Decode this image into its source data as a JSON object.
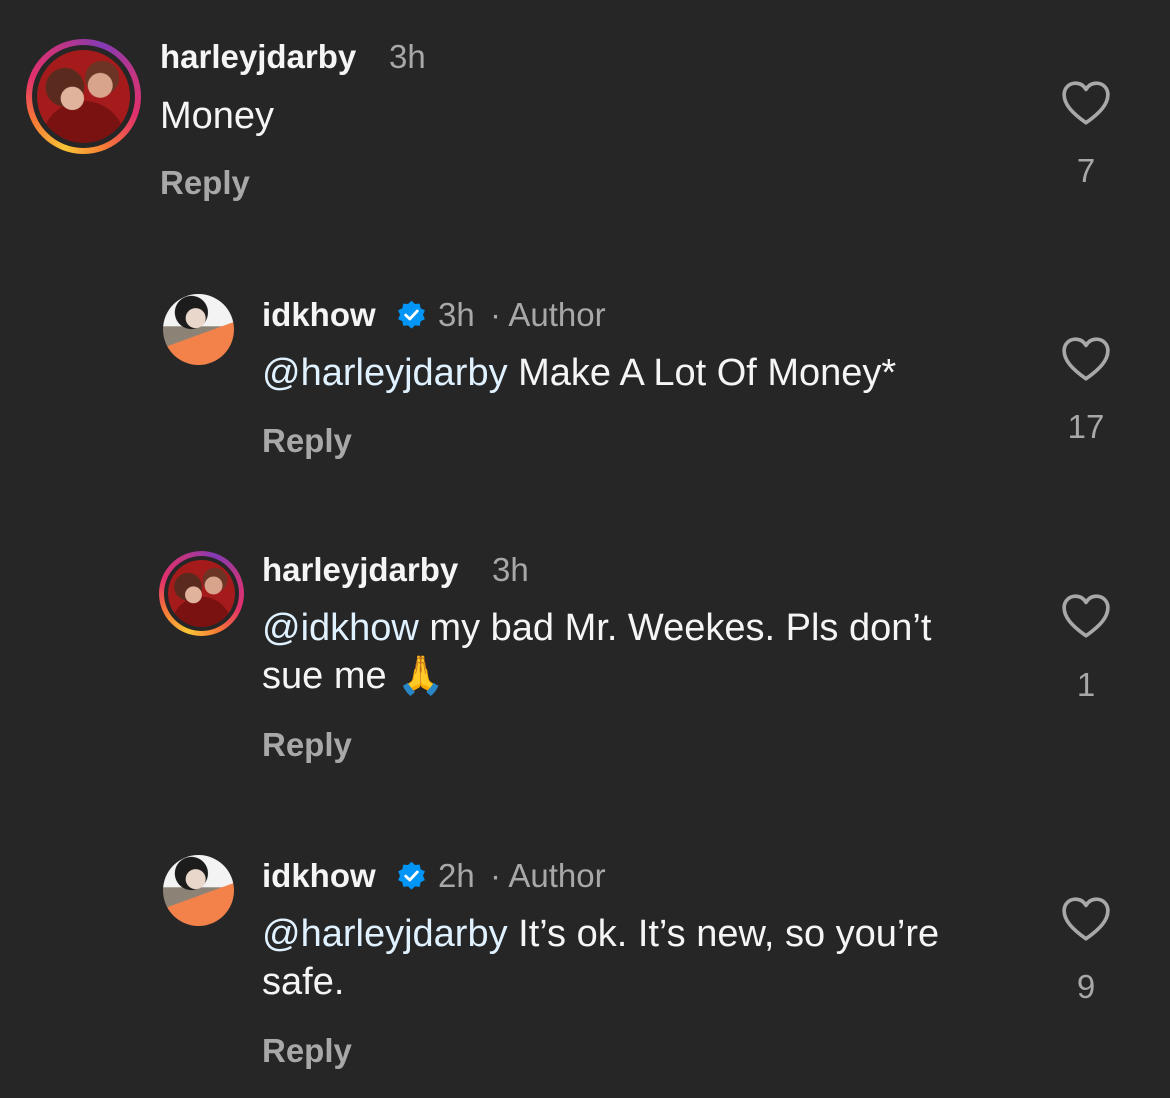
{
  "comments": [
    {
      "username": "harleyjdarby",
      "time": "3h",
      "author_tag": "",
      "mention": "",
      "text": "Money",
      "reply_label": "Reply",
      "like_count": "7",
      "avatar": "harleyjdarby-avatar-with-story-ring"
    },
    {
      "username": "idkhow",
      "time": "3h",
      "author_tag": "· Author",
      "mention": "@harleyjdarby",
      "text": " Make A Lot Of Money*",
      "reply_label": "Reply",
      "like_count": "17",
      "avatar": "idkhow-avatar",
      "verified": true
    },
    {
      "username": "harleyjdarby",
      "time": "3h",
      "author_tag": "",
      "mention": "@idkhow",
      "text": " my bad Mr. Weekes. Pls don’t sue me 🙏",
      "reply_label": "Reply",
      "like_count": "1",
      "avatar": "harleyjdarby-avatar-with-story-ring"
    },
    {
      "username": "idkhow",
      "time": "2h",
      "author_tag": "· Author",
      "mention": "@harleyjdarby",
      "text": " It’s ok. It’s new, so you’re safe.",
      "reply_label": "Reply",
      "like_count": "9",
      "avatar": "idkhow-avatar",
      "verified": true
    }
  ],
  "icons": {
    "like": "heart-outline-icon",
    "verified": "verified-badge-icon"
  },
  "colors": {
    "background": "#262626",
    "primary_text": "#f5f5f5",
    "secondary_text": "#a8a8a8",
    "mention": "#e0f1ff",
    "verified_blue": "#0095f6"
  }
}
